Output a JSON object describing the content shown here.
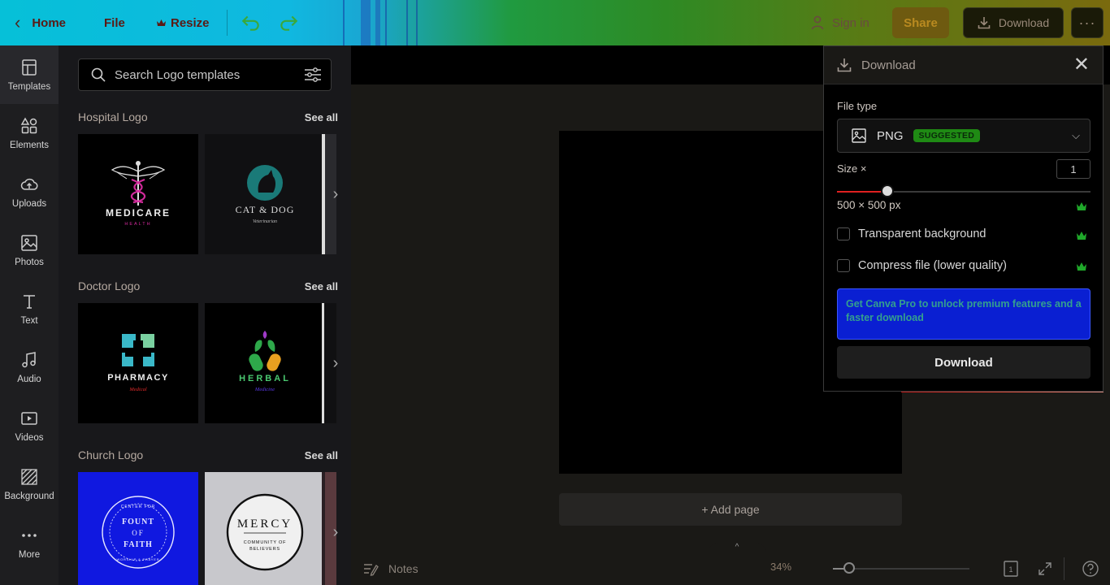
{
  "topbar": {
    "home_label": "Home",
    "file_label": "File",
    "resize_label": "Resize",
    "resize_icon": "crown-icon",
    "signin_label": "Sign in",
    "share_label": "Share",
    "download_label": "Download",
    "more_label": "···"
  },
  "rail": {
    "items": [
      {
        "label": "Templates",
        "icon": "templates-icon"
      },
      {
        "label": "Elements",
        "icon": "elements-icon"
      },
      {
        "label": "Uploads",
        "icon": "upload-cloud-icon"
      },
      {
        "label": "Photos",
        "icon": "photo-icon"
      },
      {
        "label": "Text",
        "icon": "text-icon"
      },
      {
        "label": "Audio",
        "icon": "music-note-icon"
      },
      {
        "label": "Videos",
        "icon": "video-icon"
      },
      {
        "label": "Background",
        "icon": "background-icon"
      },
      {
        "label": "More",
        "icon": "more-dots-icon"
      }
    ]
  },
  "panel": {
    "search_placeholder": "Search Logo templates",
    "sections": [
      {
        "title": "Hospital Logo",
        "see_all": "See all",
        "thumbs": [
          {
            "line1": "MEDICARE",
            "line2": "HEALTH"
          },
          {
            "line1": "CAT & DOG",
            "line2": "Veterinarian"
          }
        ]
      },
      {
        "title": "Doctor Logo",
        "see_all": "See all",
        "thumbs": [
          {
            "line1": "PHARMACY",
            "line2": "Medical"
          },
          {
            "line1": "HERBAL",
            "line2": "Medicine"
          }
        ]
      },
      {
        "title": "Church Logo",
        "see_all": "See all",
        "thumbs": [
          {
            "line1": "FOUNT",
            "line2": "OF",
            "line3": "FAITH",
            "top": "CENTER FOR",
            "bottom": "WORSHIP & PRAYER"
          },
          {
            "line1": "MERCY",
            "line2": "COMMUNITY OF",
            "line3": "BELIEVERS"
          }
        ]
      }
    ]
  },
  "canvas": {
    "add_page_label": "+ Add page"
  },
  "bottombar": {
    "notes_label": "Notes",
    "zoom": "34%",
    "zoom_level": 0.12,
    "page_count": "1"
  },
  "download_panel": {
    "title": "Download",
    "file_type_label": "File type",
    "file_type_value": "PNG",
    "suggested_badge": "SUGGESTED",
    "size_label": "Size ×",
    "size_value": "1",
    "size_slider_level": 0.2,
    "dimensions": "500 × 500 px",
    "transparent_label": "Transparent background",
    "compress_label": "Compress file (lower quality)",
    "promo_text": "Get Canva Pro to unlock premium features and a faster download",
    "download_button": "Download"
  },
  "colors": {
    "accent_red": "#e02020",
    "badge_green": "#1f8a14",
    "promo_blue": "#0a1fd2"
  }
}
